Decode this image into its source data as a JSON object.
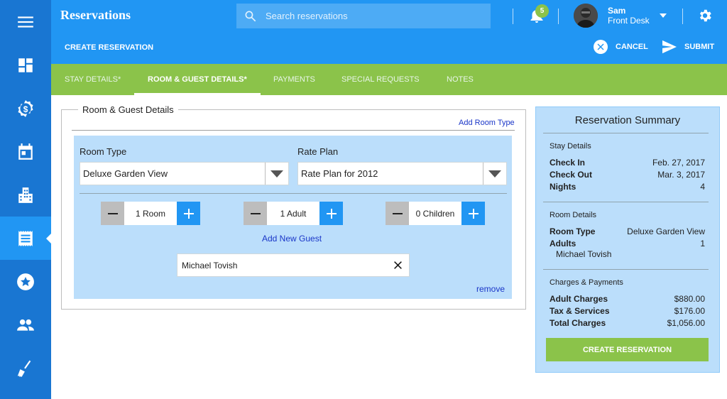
{
  "app": {
    "title": "Reservations"
  },
  "search": {
    "placeholder": "Search reservations"
  },
  "notifications": {
    "count": "5"
  },
  "user": {
    "name": "Sam",
    "role": "Front Desk"
  },
  "action_bar": {
    "title": "CREATE RESERVATION",
    "cancel_label": "CANCEL",
    "submit_label": "SUBMIT"
  },
  "sidebar": {
    "items": [
      {
        "icon": "menu-icon"
      },
      {
        "icon": "dashboard-icon"
      },
      {
        "icon": "dollar-badge-icon"
      },
      {
        "icon": "calendar-icon"
      },
      {
        "icon": "building-icon"
      },
      {
        "icon": "receipt-icon",
        "active": true
      },
      {
        "icon": "star-icon"
      },
      {
        "icon": "people-icon"
      },
      {
        "icon": "broom-icon"
      }
    ]
  },
  "tabs": [
    {
      "label": "STAY DETAILS*"
    },
    {
      "label": "ROOM & GUEST DETAILS*",
      "active": true
    },
    {
      "label": "PAYMENTS"
    },
    {
      "label": "SPECIAL REQUESTS"
    },
    {
      "label": "NOTES"
    }
  ],
  "form": {
    "legend": "Room & Guest Details",
    "add_room_type": "Add Room Type",
    "room_type_label": "Room Type",
    "room_type_value": "Deluxe Garden View",
    "rate_plan_label": "Rate Plan",
    "rate_plan_value": "Rate Plan for 2012",
    "rooms": "1 Room",
    "adults": "1 Adult",
    "children": "0 Children",
    "add_guest": "Add New Guest",
    "guest_name": "Michael Tovish",
    "remove": "remove"
  },
  "summary": {
    "title": "Reservation Summary",
    "stay_section": "Stay Details",
    "check_in_label": "Check In",
    "check_in_value": "Feb. 27, 2017",
    "check_out_label": "Check Out",
    "check_out_value": "Mar. 3, 2017",
    "nights_label": "Nights",
    "nights_value": "4",
    "room_section": "Room Details",
    "room_type_label": "Room Type",
    "room_type_value": "Deluxe Garden View",
    "adults_label": "Adults",
    "adults_value": "1",
    "guest_name": "Michael Tovish",
    "charges_section": "Charges & Payments",
    "adult_charges_label": "Adult Charges",
    "adult_charges_value": "$880.00",
    "tax_label": "Tax & Services",
    "tax_value": "$176.00",
    "total_label": "Total Charges",
    "total_value": "$1,056.00",
    "create_button": "CREATE RESERVATION"
  },
  "colors": {
    "primary": "#2196f3",
    "sidebar": "#1976d2",
    "accent_green": "#8bc34a",
    "panel_blue": "#bbdefb",
    "link": "#1a36c8"
  }
}
